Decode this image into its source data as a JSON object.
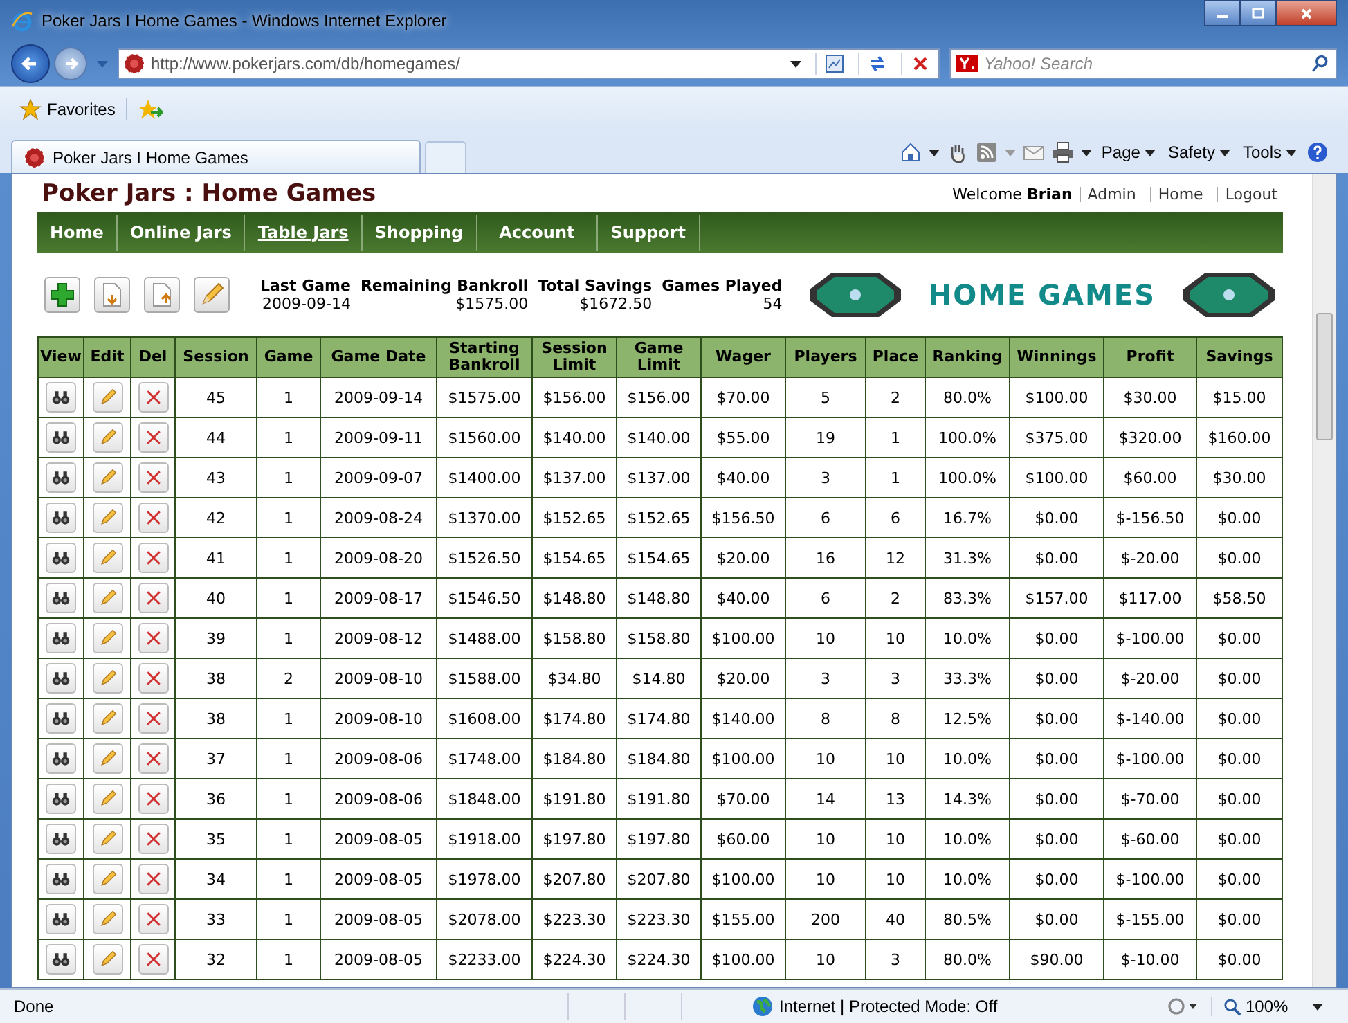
{
  "window": {
    "title": "Poker Jars I Home Games - Windows Internet Explorer"
  },
  "address_bar": {
    "url": "http://www.pokerjars.com/db/homegames/"
  },
  "search": {
    "placeholder": "Yahoo! Search"
  },
  "favorites": {
    "label": "Favorites"
  },
  "tab": {
    "title": "Poker Jars I Home Games"
  },
  "command_bar": [
    "Page",
    "Safety",
    "Tools"
  ],
  "page": {
    "title": "Poker Jars : Home Games",
    "welcome": "Welcome **Brian**",
    "user_links": [
      "Admin",
      "Home",
      "Logout"
    ],
    "nav": [
      {
        "label": "Home",
        "selected": false
      },
      {
        "label": "Online Jars",
        "selected": false
      },
      {
        "label": "Table Jars",
        "selected": true
      },
      {
        "label": "Shopping",
        "selected": false
      },
      {
        "label": "Account",
        "selected": false
      },
      {
        "label": "Support",
        "selected": false
      }
    ],
    "stats": [
      {
        "label": "Last Game",
        "value": "2009-09-14"
      },
      {
        "label": "Remaining Bankroll",
        "value": "$1575.00"
      },
      {
        "label": "Total Savings",
        "value": "$1672.50"
      },
      {
        "label": "Games Played",
        "value": "54"
      }
    ],
    "banner": "HOME GAMES"
  },
  "table": {
    "action_columns": [
      "View",
      "Edit",
      "Del"
    ],
    "columns": [
      "Session",
      "Game",
      "Game Date",
      "Starting Bankroll",
      "Session Limit",
      "Game Limit",
      "Wager",
      "Players",
      "Place",
      "Ranking",
      "Winnings",
      "Profit",
      "Savings"
    ],
    "rows": [
      [
        "45",
        "1",
        "2009-09-14",
        "$1575.00",
        "$156.00",
        "$156.00",
        "$70.00",
        "5",
        "2",
        "80.0%",
        "$100.00",
        "$30.00",
        "$15.00"
      ],
      [
        "44",
        "1",
        "2009-09-11",
        "$1560.00",
        "$140.00",
        "$140.00",
        "$55.00",
        "19",
        "1",
        "100.0%",
        "$375.00",
        "$320.00",
        "$160.00"
      ],
      [
        "43",
        "1",
        "2009-09-07",
        "$1400.00",
        "$137.00",
        "$137.00",
        "$40.00",
        "3",
        "1",
        "100.0%",
        "$100.00",
        "$60.00",
        "$30.00"
      ],
      [
        "42",
        "1",
        "2009-08-24",
        "$1370.00",
        "$152.65",
        "$152.65",
        "$156.50",
        "6",
        "6",
        "16.7%",
        "$0.00",
        "$-156.50",
        "$0.00"
      ],
      [
        "41",
        "1",
        "2009-08-20",
        "$1526.50",
        "$154.65",
        "$154.65",
        "$20.00",
        "16",
        "12",
        "31.3%",
        "$0.00",
        "$-20.00",
        "$0.00"
      ],
      [
        "40",
        "1",
        "2009-08-17",
        "$1546.50",
        "$148.80",
        "$148.80",
        "$40.00",
        "6",
        "2",
        "83.3%",
        "$157.00",
        "$117.00",
        "$58.50"
      ],
      [
        "39",
        "1",
        "2009-08-12",
        "$1488.00",
        "$158.80",
        "$158.80",
        "$100.00",
        "10",
        "10",
        "10.0%",
        "$0.00",
        "$-100.00",
        "$0.00"
      ],
      [
        "38",
        "2",
        "2009-08-10",
        "$1588.00",
        "$34.80",
        "$14.80",
        "$20.00",
        "3",
        "3",
        "33.3%",
        "$0.00",
        "$-20.00",
        "$0.00"
      ],
      [
        "38",
        "1",
        "2009-08-10",
        "$1608.00",
        "$174.80",
        "$174.80",
        "$140.00",
        "8",
        "8",
        "12.5%",
        "$0.00",
        "$-140.00",
        "$0.00"
      ],
      [
        "37",
        "1",
        "2009-08-06",
        "$1748.00",
        "$184.80",
        "$184.80",
        "$100.00",
        "10",
        "10",
        "10.0%",
        "$0.00",
        "$-100.00",
        "$0.00"
      ],
      [
        "36",
        "1",
        "2009-08-06",
        "$1848.00",
        "$191.80",
        "$191.80",
        "$70.00",
        "14",
        "13",
        "14.3%",
        "$0.00",
        "$-70.00",
        "$0.00"
      ],
      [
        "35",
        "1",
        "2009-08-05",
        "$1918.00",
        "$197.80",
        "$197.80",
        "$60.00",
        "10",
        "10",
        "10.0%",
        "$0.00",
        "$-60.00",
        "$0.00"
      ],
      [
        "34",
        "1",
        "2009-08-05",
        "$1978.00",
        "$207.80",
        "$207.80",
        "$100.00",
        "10",
        "10",
        "10.0%",
        "$0.00",
        "$-100.00",
        "$0.00"
      ],
      [
        "33",
        "1",
        "2009-08-05",
        "$2078.00",
        "$223.30",
        "$223.30",
        "$155.00",
        "200",
        "40",
        "80.5%",
        "$0.00",
        "$-155.00",
        "$0.00"
      ],
      [
        "32",
        "1",
        "2009-08-05",
        "$2233.00",
        "$224.30",
        "$224.30",
        "$100.00",
        "10",
        "3",
        "80.0%",
        "$90.00",
        "$-10.00",
        "$0.00"
      ]
    ]
  },
  "status_bar": {
    "text": "Done",
    "zone": "Internet | Protected Mode: Off",
    "zoom": "100%"
  }
}
